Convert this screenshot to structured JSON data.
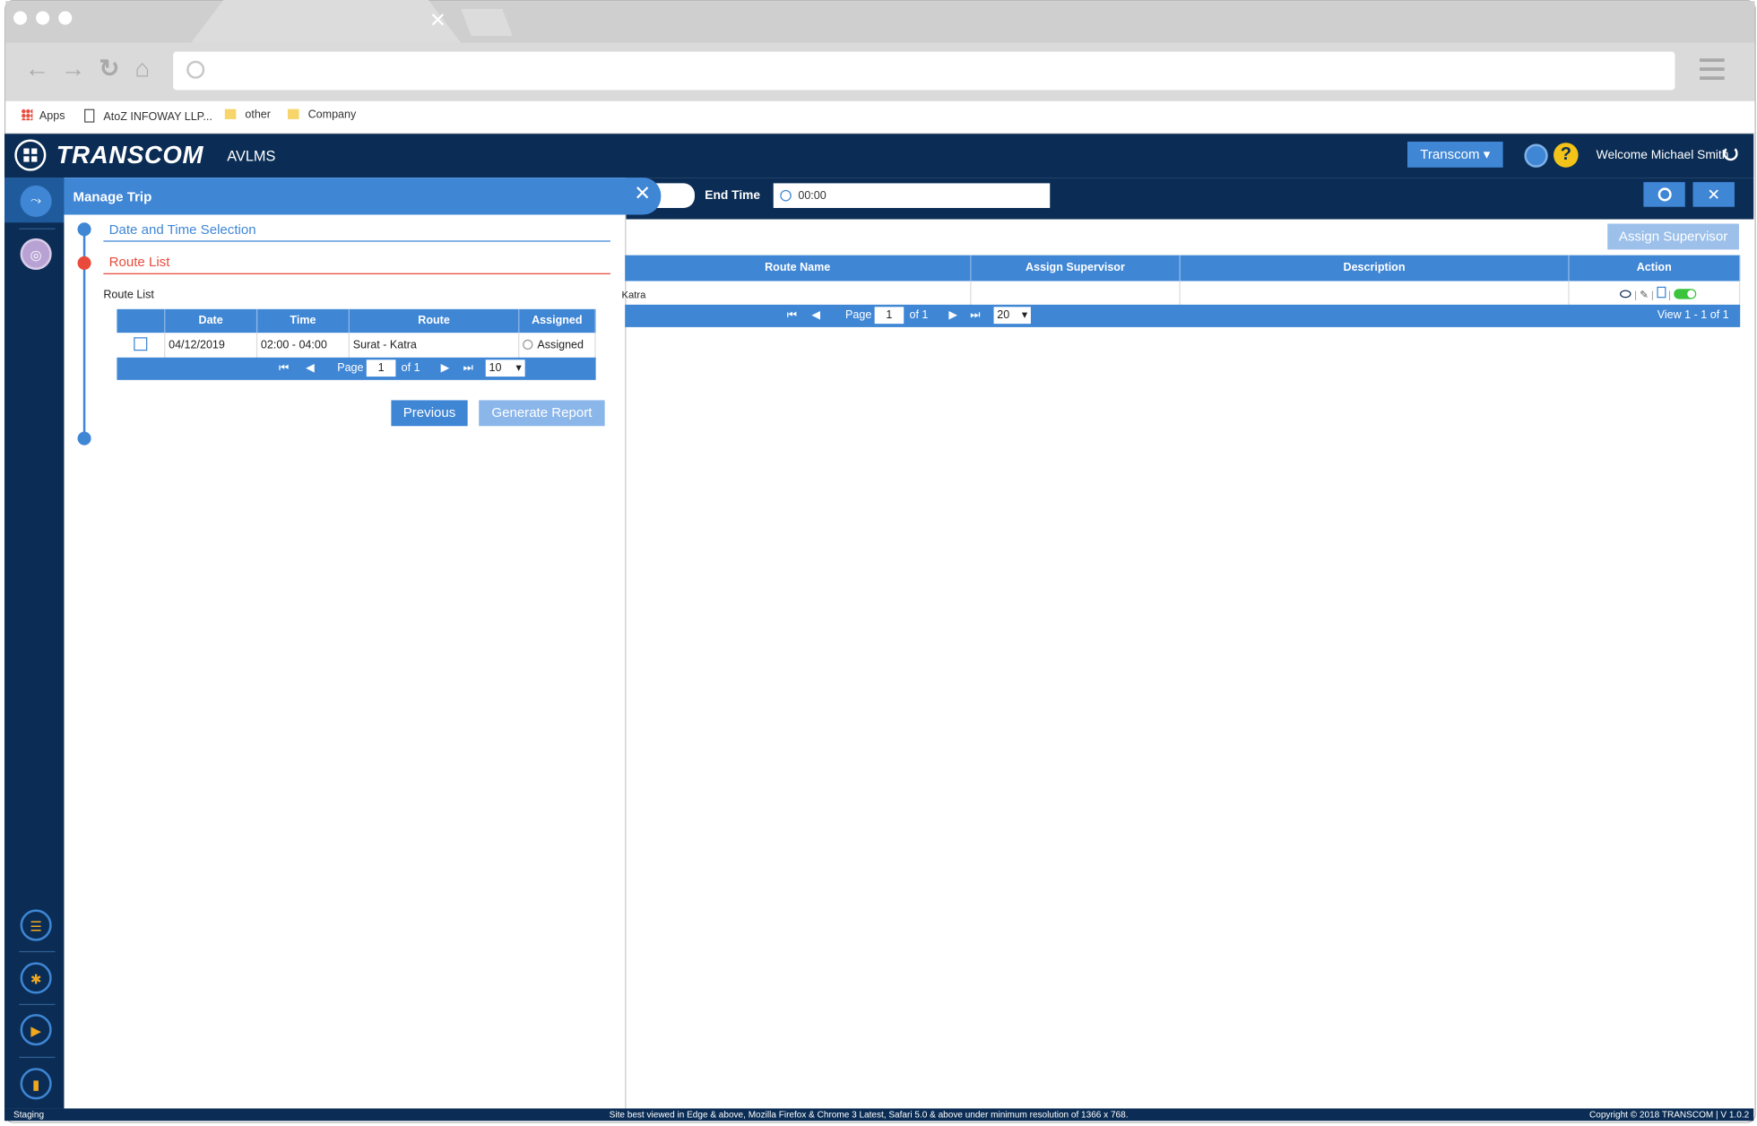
{
  "browser": {
    "tab_close_icon": "close-icon",
    "bookmarks": [
      {
        "label": "Apps",
        "icon": "apps-grid-icon"
      },
      {
        "label": "AtoZ INFOWAY LLP...",
        "icon": "page-icon"
      },
      {
        "label": "other",
        "icon": "folder-icon"
      },
      {
        "label": "Company",
        "icon": "folder-icon"
      }
    ]
  },
  "header": {
    "logo_text": "TRANSCOM",
    "app_name": "AVLMS",
    "org_button": "Transcom ▾",
    "help_glyph": "?",
    "welcome": "Welcome Michael Smith"
  },
  "filter": {
    "end_time_label": "End Time",
    "end_time_value": "00:00"
  },
  "panel": {
    "title": "Manage Trip",
    "step1": "Date and Time Selection",
    "step2": "Route List",
    "route_list_label": "Route List",
    "columns": [
      "Date",
      "Time",
      "Route",
      "Assigned"
    ],
    "rows": [
      {
        "date": "04/12/2019",
        "time": "02:00 - 04:00",
        "route": "Surat - Katra",
        "assigned": "Assigned"
      }
    ],
    "pager": {
      "page_label": "Page",
      "page": "1",
      "of": "of 1",
      "per_page": "10"
    },
    "previous_button": "Previous",
    "generate_button": "Generate Report"
  },
  "main": {
    "assign_button": "Assign Supervisor",
    "columns": [
      "Route Name",
      "Assign Supervisor",
      "Description",
      "Action"
    ],
    "rows": [
      {
        "route_name": "Katra",
        "supervisor": "",
        "description": ""
      }
    ],
    "pager": {
      "page_label": "Page",
      "page": "1",
      "of": "of 1",
      "per_page": "20",
      "view": "View 1 - 1 of 1"
    }
  },
  "footer": {
    "left": "Staging",
    "center": "Site best viewed in Edge & above, Mozilla Firefox & Chrome 3 Latest, Safari 5.0 & above under minimum resolution of 1366 x 768.",
    "right": "Copyright © 2018 TRANSCOM | V 1.0.2"
  },
  "colors": {
    "navy": "#0b2d55",
    "accent": "#3f86d5",
    "active_step": "#e84b3c",
    "toggle_on": "#3cc33c"
  }
}
